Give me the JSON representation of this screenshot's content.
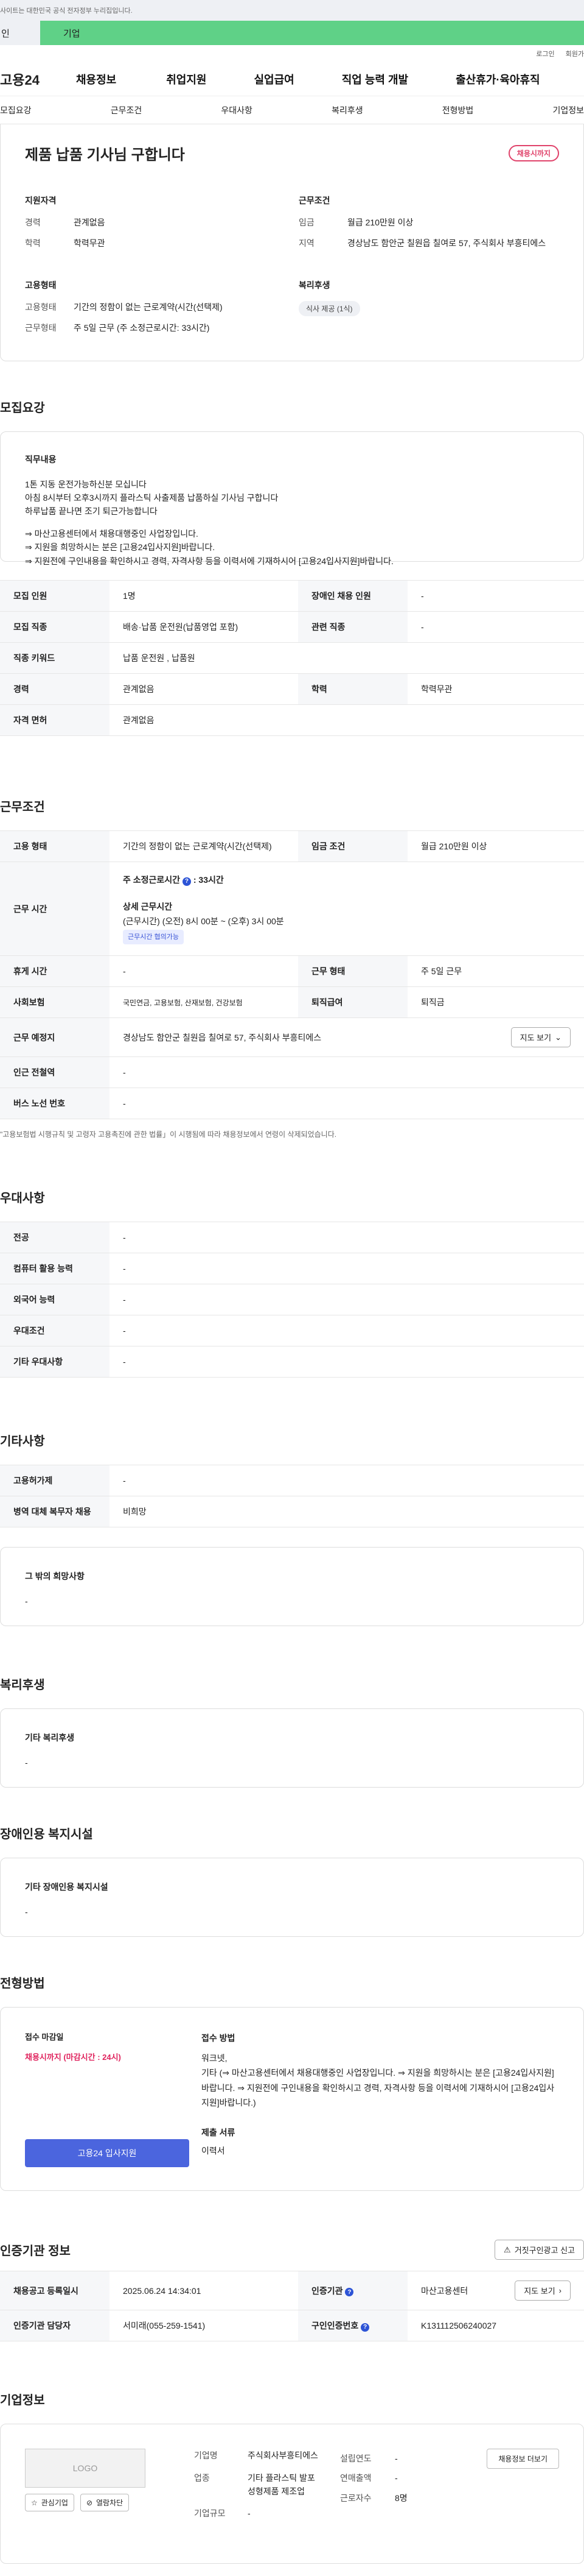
{
  "gov_banner": "사이트는 대한민국 공식 전자정부 누리집입니다.",
  "tabs": [
    "인",
    "기업"
  ],
  "util": [
    "로그인",
    "회원가"
  ],
  "brand": "고용24",
  "gnb": [
    "채용정보",
    "취업지원",
    "실업급여",
    "직업 능력 개발",
    "출산휴가·육아휴직"
  ],
  "subnav": [
    "모집요강",
    "근무조건",
    "우대사항",
    "복리후생",
    "전형방법",
    "기업정보"
  ],
  "summary": {
    "title": "제품 납품 기사님 구합니다",
    "status": "채용시까지",
    "qual_h": "지원자격",
    "career_k": "경력",
    "career_v": "관계없음",
    "edu_k": "학력",
    "edu_v": "학력무관",
    "cond_h": "근무조건",
    "wage_k": "임금",
    "wage_v": "월급 210만원 이상",
    "region_k": "지역",
    "region_v": "경상남도 함안군 칠원읍 칠여로 57, 주식회사 부흥티에스",
    "form_h": "고용형태",
    "type_k": "고용형태",
    "type_v": "기간의 정함이 없는 근로계약(시간(선택제)",
    "work_k": "근무형태",
    "work_v": "주 5일 근무 (주 소정근로시간: 33시간)",
    "welfare_h": "복리후생",
    "welfare_chip": "식사 제공 (1식)"
  },
  "recruit": {
    "heading": "모집요강",
    "duty_h": "직무내용",
    "duty_lines": [
      "1톤 지동 운전가능하신분 모십니다",
      "아침 8시부터 오후3시까지 플라스틱 사출제품 납품하실 기사님 구합니다",
      "하루납품 끝나면 조기 퇴근가능합니다",
      "",
      "⇒ 마산고용센터에서 채용대행중인 사업장입니다.",
      "⇒ 지원을 희망하시는 분은 [고용24입사지원]바랍니다.",
      "⇒ 지원전에 구인내용을 확인하시고 경력, 자격사항 등을 이력서에 기재하시어 [고용24입사지원]바랍니다."
    ],
    "rows": [
      [
        "모집 인원",
        "1명",
        "장애인 채용 인원",
        "-"
      ],
      [
        "모집 직종",
        "배송·납품 운전원(납품영업 포함)",
        "관련 직종",
        "-"
      ],
      [
        "직종 키워드",
        "납품 운전원 , 납품원",
        "",
        ""
      ],
      [
        "경력",
        "관계없음",
        "학력",
        "학력무관"
      ],
      [
        "자격 면허",
        "관계없음",
        "",
        ""
      ]
    ]
  },
  "work": {
    "heading": "근무조건",
    "emp_k": "고용 형태",
    "emp_v": "기간의 정함이 없는 근로계약(시간(선택제)",
    "wage_k": "임금 조건",
    "wage_v": "월급 210만원 이상",
    "time_k": "근무 시간",
    "time_main": "주 소정근로시간",
    "time_hours": "33시간",
    "time_detail_h": "상세 근무시간",
    "time_detail": "(근무시간) (오전) 8시 00분 ~ (오후) 3시 00분",
    "time_pill": "근무시간 협의가능",
    "rest_k": "휴게 시간",
    "rest_v": "-",
    "form_k": "근무 형태",
    "form_v": "주 5일 근무",
    "ins_k": "사회보험",
    "ins_v": "국민연금, 고용보험, 산재보험, 건강보험",
    "sev_k": "퇴직급여",
    "sev_v": "퇴직금",
    "place_k": "근무 예정지",
    "place_v": "경상남도 함안군 칠원읍 칠여로 57, 주식회사 부흥티에스",
    "map_btn": "지도 보기",
    "sub_k": "인근 전철역",
    "sub_v": "-",
    "bus_k": "버스 노선 번호",
    "bus_v": "-",
    "note": "\"고용보험법 시행규칙 및 고령자 고용촉진에 관한 법률」이 시행됨에 따라 채용정보에서 연령이 삭제되었습니다."
  },
  "pref": {
    "heading": "우대사항",
    "rows": [
      [
        "전공",
        "-"
      ],
      [
        "컴퓨터 활용 능력",
        "-"
      ],
      [
        "외국어 능력",
        "-"
      ],
      [
        "우대조건",
        "-"
      ],
      [
        "기타 우대사항",
        "-"
      ]
    ]
  },
  "etc": {
    "heading": "기타사항",
    "rows": [
      [
        "고용허가제",
        "-"
      ],
      [
        "병역 대체 복무자 채용",
        "비희망"
      ]
    ],
    "box_h": "그 밖의 희망사항",
    "box_v": "-"
  },
  "welfare": {
    "heading": "복리후생",
    "box_h": "기타 복리후생",
    "box_v": "-"
  },
  "disab": {
    "heading": "장애인용 복지시설",
    "box_h": "기타 장애인용 복지시설",
    "box_v": "-"
  },
  "select": {
    "heading": "전형방법",
    "deadline_h": "접수 마감일",
    "deadline_v": "채용시까지 (마감시간 : 24시)",
    "apply_btn": "고용24 입사지원",
    "method_h": "접수 방법",
    "method_v1": "워크넷,",
    "method_v2": "기타 (⇒ 마산고용센터에서 채용대행중인 사업장입니다. ⇒ 지원을 희망하시는 분은 [고용24입사지원]바랍니다. ⇒ 지원전에 구인내용을 확인하시고 경력, 자격사항 등을 이력서에 기재하시어 [고용24입사지원]바랍니다.)",
    "docs_h": "제출 서류",
    "docs_v": "이력서"
  },
  "cert": {
    "heading": "인증기관 정보",
    "report_btn": "거짓구인광고 신고",
    "reg_k": "채용공고 등록일시",
    "reg_v": "2025.06.24 14:34:01",
    "org_k": "인증기관",
    "org_v": "마산고용센터",
    "map_btn": "지도 보기",
    "mgr_k": "인증기관 담당자",
    "mgr_v": "서미래(055-259-1541)",
    "num_k": "구인인증번호",
    "num_v": "K131112506240027"
  },
  "company": {
    "heading": "기업정보",
    "logo": "LOGO",
    "fav_btn": "관심기업",
    "block_btn": "열람차단",
    "name_k": "기업명",
    "name_v": "주식회사부흥티에스",
    "ind_k": "업종",
    "ind_v": "기타 플라스틱 발포 성형제품 제조업",
    "scale_k": "기업규모",
    "scale_v": "-",
    "year_k": "설립연도",
    "year_v": "-",
    "rev_k": "연매출액",
    "rev_v": "-",
    "emp_k": "근로자수",
    "emp_v": "8명",
    "more_btn": "채용정보 더보기"
  }
}
